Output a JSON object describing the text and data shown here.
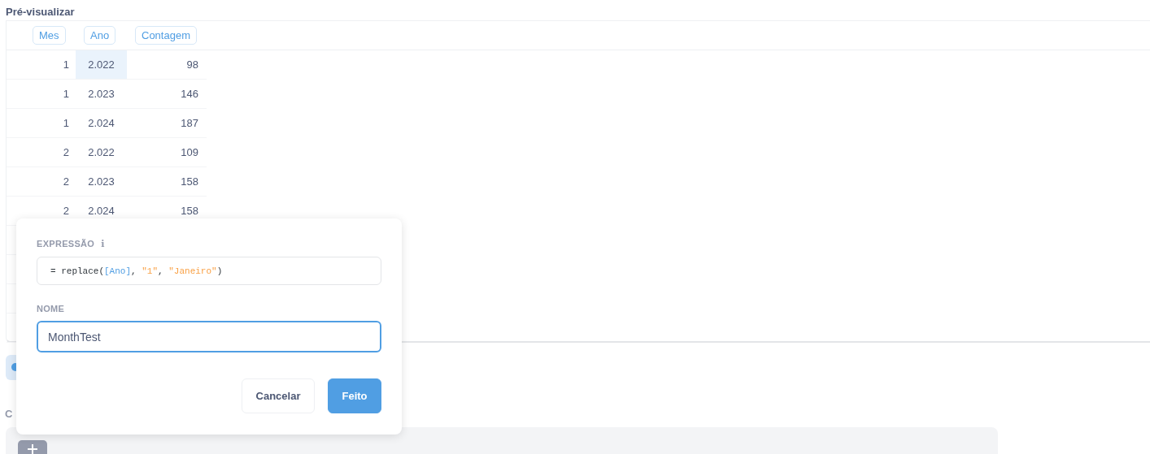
{
  "preview": {
    "title": "Pré-visualizar",
    "columns": [
      "Mes",
      "Ano",
      "Contagem"
    ],
    "rows": [
      {
        "cells": [
          {
            "text": "1",
            "selected": false
          },
          {
            "text": "2.022",
            "selected": true
          },
          {
            "text": "98",
            "selected": false
          }
        ]
      },
      {
        "cells": [
          {
            "text": "1",
            "selected": false
          },
          {
            "text": "2.023",
            "selected": false
          },
          {
            "text": "146",
            "selected": false
          }
        ]
      },
      {
        "cells": [
          {
            "text": "1",
            "selected": false
          },
          {
            "text": "2.024",
            "selected": false
          },
          {
            "text": "187",
            "selected": false
          }
        ]
      },
      {
        "cells": [
          {
            "text": "2",
            "selected": false
          },
          {
            "text": "2.022",
            "selected": false
          },
          {
            "text": "109",
            "selected": false
          }
        ]
      },
      {
        "cells": [
          {
            "text": "2",
            "selected": false
          },
          {
            "text": "2.023",
            "selected": false
          },
          {
            "text": "158",
            "selected": false
          }
        ]
      },
      {
        "cells": [
          {
            "text": "2",
            "selected": false
          },
          {
            "text": "2.024",
            "selected": false
          },
          {
            "text": "158",
            "selected": false
          }
        ]
      }
    ]
  },
  "section_label": "C",
  "dialog": {
    "expression_label": "EXPRESSÃO",
    "info_icon": "i",
    "expression": [
      {
        "kind": "plain",
        "text": "= replace("
      },
      {
        "kind": "field",
        "text": "[Ano]"
      },
      {
        "kind": "plain",
        "text": ", "
      },
      {
        "kind": "string",
        "text": "\"1\""
      },
      {
        "kind": "plain",
        "text": ", "
      },
      {
        "kind": "string",
        "text": "\"Janeiro\""
      },
      {
        "kind": "plain",
        "text": ")"
      }
    ],
    "name_label": "NOME",
    "name_value": "MonthTest",
    "buttons": [
      {
        "label": "Cancelar",
        "kind": "secondary"
      },
      {
        "label": "Feito",
        "kind": "primary"
      }
    ]
  }
}
